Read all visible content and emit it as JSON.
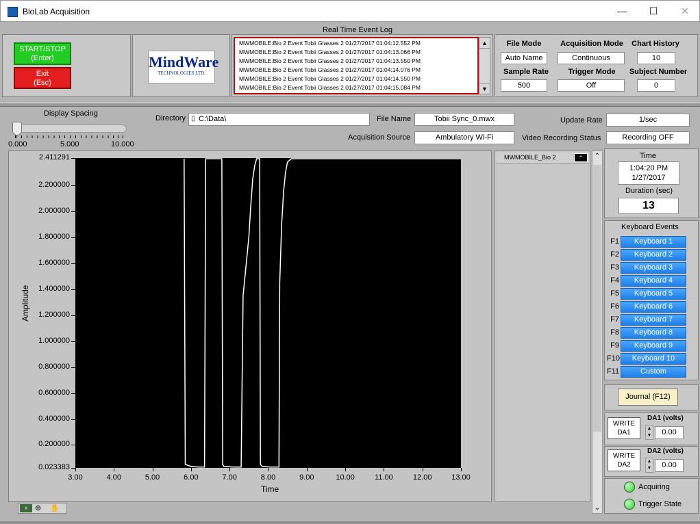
{
  "window": {
    "title": "BioLab Acquisition",
    "minimize": "—",
    "maximize": "☐",
    "close": "✕"
  },
  "controls": {
    "start_stop": "START/STOP\n(Enter)",
    "exit": "Exit\n(Esc)"
  },
  "logo": {
    "line1": "MindWare",
    "line2": "TECHNOLOGIES LTD."
  },
  "event_log": {
    "title": "Real Time Event Log",
    "entries": [
      "MWMOBILE:Bio 2 Event Tobii Glasses 2 01/27/2017 01:04:12.552 PM",
      "MWMOBILE:Bio 2 Event Tobii Glasses 2 01/27/2017 01:04:13.066 PM",
      "MWMOBILE:Bio 2 Event Tobii Glasses 2 01/27/2017 01:04:13.550 PM",
      "MWMOBILE:Bio 2 Event Tobii Glasses 2 01/27/2017 01:04:14.076 PM",
      "MWMOBILE:Bio 2 Event Tobii Glasses 2 01/27/2017 01:04:14.550 PM",
      "MWMOBILE:Bio 2 Event Tobii Glasses 2 01/27/2017 01:04:15.084 PM"
    ]
  },
  "settings": {
    "file_mode_label": "File Mode",
    "file_mode": "Auto Name",
    "acq_mode_label": "Acquisition Mode",
    "acq_mode": "Continuous",
    "chart_history_label": "Chart History",
    "chart_history": "10",
    "sample_rate_label": "Sample Rate",
    "sample_rate": "500",
    "trigger_mode_label": "Trigger Mode",
    "trigger_mode": "Off",
    "subject_number_label": "Subject Number",
    "subject_number": "0"
  },
  "display": {
    "spacing_label": "Display Spacing",
    "spacing_min": "0.000",
    "spacing_mid": "5.000",
    "spacing_max": "10.000",
    "directory_label": "Directory",
    "directory": "C:\\Data\\",
    "file_name_label": "File Name",
    "file_name": "Tobii Sync_0.mwx",
    "acq_source_label": "Acquisition Source",
    "acq_source": "Ambulatory Wi-Fi",
    "update_rate_label": "Update Rate",
    "update_rate": "1/sec",
    "video_status_label": "Video Recording Status",
    "video_status": "Recording OFF"
  },
  "channel": {
    "name": "MWMOBILE_Bio 2"
  },
  "time_panel": {
    "label": "Time",
    "time": "1:04:20 PM",
    "date": "1/27/2017",
    "duration_label": "Duration (sec)",
    "duration": "13"
  },
  "keyboard_events": {
    "title": "Keyboard Events",
    "items": [
      {
        "key": "F1",
        "label": "Keyboard 1"
      },
      {
        "key": "F2",
        "label": "Keyboard 2"
      },
      {
        "key": "F3",
        "label": "Keyboard 3"
      },
      {
        "key": "F4",
        "label": "Keyboard 4"
      },
      {
        "key": "F5",
        "label": "Keyboard 5"
      },
      {
        "key": "F6",
        "label": "Keyboard 6"
      },
      {
        "key": "F7",
        "label": "Keyboard 7"
      },
      {
        "key": "F8",
        "label": "Keyboard 8"
      },
      {
        "key": "F9",
        "label": "Keyboard 9"
      },
      {
        "key": "F10",
        "label": "Keyboard 10"
      },
      {
        "key": "F11",
        "label": "Custom"
      }
    ]
  },
  "journal": {
    "label": "Journal (F12)"
  },
  "da": {
    "write1": "WRITE\nDA1",
    "da1_label": "DA1 (volts)",
    "da1_value": "0.00",
    "write2": "WRITE\nDA2",
    "da2_label": "DA2 (volts)",
    "da2_value": "0.00"
  },
  "status": {
    "acquiring": "Acquiring",
    "trigger_state": "Trigger State",
    "led_color": "#33cc33"
  },
  "chart_data": {
    "type": "line",
    "xlabel": "Time",
    "ylabel": "Amplitude",
    "xlim": [
      3.0,
      13.0
    ],
    "ylim": [
      0.023383,
      2.411291
    ],
    "x_ticks": [
      "3.00",
      "4.00",
      "5.00",
      "6.00",
      "7.00",
      "8.00",
      "9.00",
      "10.00",
      "11.00",
      "12.00",
      "13.00"
    ],
    "y_ticks": [
      "2.411291",
      "2.200000",
      "2.000000",
      "1.800000",
      "1.600000",
      "1.400000",
      "1.200000",
      "1.000000",
      "0.800000",
      "0.600000",
      "0.400000",
      "0.200000",
      "0.023383"
    ],
    "y_tick_values": [
      2.411291,
      2.2,
      2.0,
      1.8,
      1.6,
      1.4,
      1.2,
      1.0,
      0.8,
      0.6,
      0.4,
      0.2,
      0.023383
    ],
    "series": [
      {
        "line_color": "#ffffff",
        "x": [
          5.82,
          5.85,
          6.0,
          6.2,
          6.35,
          6.38,
          6.5,
          6.8,
          6.82,
          6.85,
          7.1,
          7.3,
          7.35,
          7.5,
          7.55,
          7.6,
          7.65,
          7.7,
          7.75,
          7.78,
          7.8,
          7.85,
          8.05,
          8.28,
          8.3,
          8.35,
          8.4,
          8.45,
          8.5,
          8.6,
          13.0
        ],
        "y": [
          2.411291,
          0.05,
          0.035,
          0.03,
          0.03,
          2.411291,
          2.411291,
          2.411291,
          0.05,
          0.035,
          0.03,
          0.03,
          1.35,
          1.8,
          2.05,
          2.25,
          2.35,
          2.411291,
          2.411291,
          2.411291,
          0.05,
          0.035,
          0.03,
          0.03,
          1.45,
          1.9,
          2.15,
          2.3,
          2.38,
          2.411291,
          2.411291
        ]
      }
    ]
  }
}
